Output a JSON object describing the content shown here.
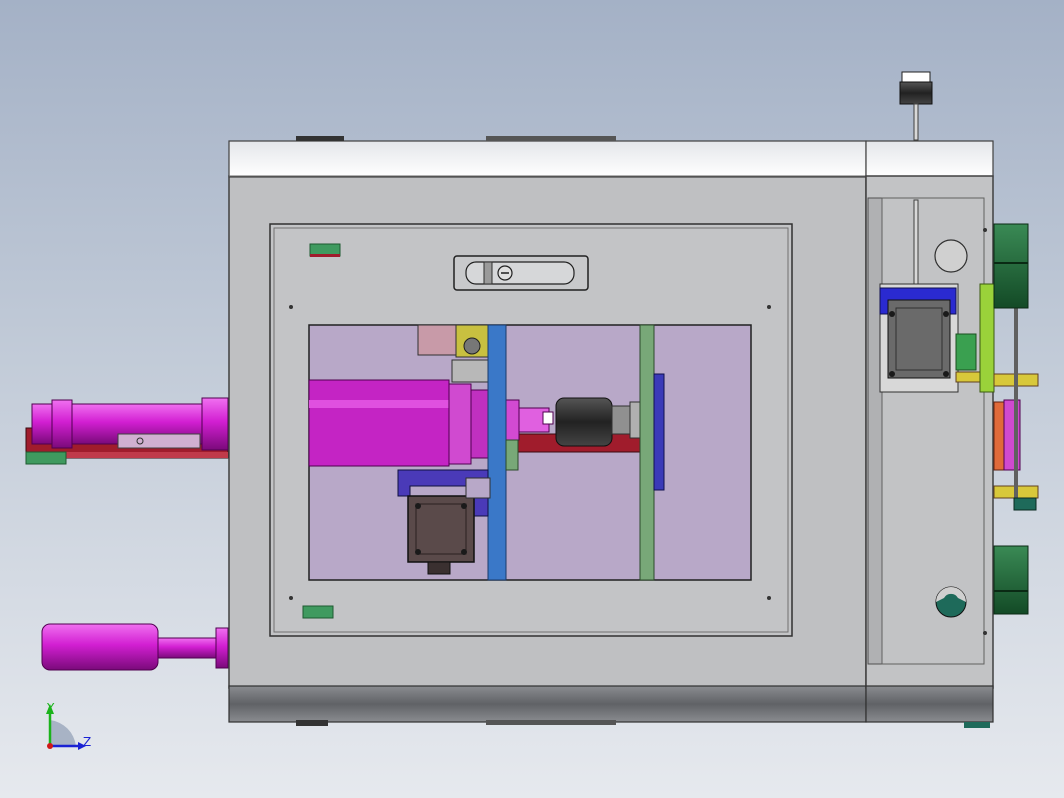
{
  "view": {
    "background_top": "#a4b1c6",
    "background_bottom": "#e6e9ee"
  },
  "triad": {
    "y_label": "Y",
    "z_label": "Z",
    "y_color": "#1bb31b",
    "z_color": "#1a22d4",
    "origin_color": "#d01818"
  },
  "colors": {
    "housing": "#bfc0c2",
    "housing_edge": "#404040",
    "cylinder": "#d21fd2",
    "motor": "#c424c4",
    "plate_blue": "#3a78c8",
    "plate_green": "#78a878",
    "rail_red": "#a01c2c",
    "block_green": "#1e6a3a",
    "servo_body": "#5a4a4a",
    "bracket_purple": "#4a3ab8",
    "arm_lime": "#9ad23a",
    "block_yellow": "#d8c83a"
  }
}
